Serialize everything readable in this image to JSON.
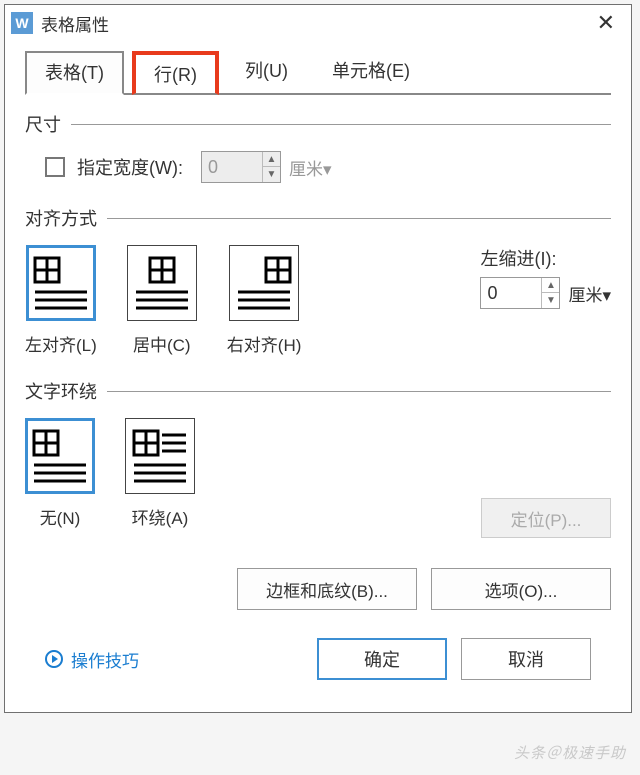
{
  "window": {
    "title": "表格属性",
    "app_glyph": "W"
  },
  "tabs": {
    "table": "表格(T)",
    "row": "行(R)",
    "column": "列(U)",
    "cell": "单元格(E)"
  },
  "size": {
    "heading": "尺寸",
    "specify_width_label": "指定宽度(W):",
    "width_value": "0",
    "width_unit": "厘米"
  },
  "align": {
    "heading": "对齐方式",
    "left": "左对齐(L)",
    "center": "居中(C)",
    "right": "右对齐(H)",
    "indent_label": "左缩进(I):",
    "indent_value": "0",
    "indent_unit": "厘米"
  },
  "wrap": {
    "heading": "文字环绕",
    "none": "无(N)",
    "around": "环绕(A)",
    "position_btn": "定位(P)..."
  },
  "buttons": {
    "borders": "边框和底纹(B)...",
    "options": "选项(O)..."
  },
  "footer": {
    "tips": "操作技巧",
    "ok": "确定",
    "cancel": "取消"
  },
  "watermark": "头条＠极速手助"
}
